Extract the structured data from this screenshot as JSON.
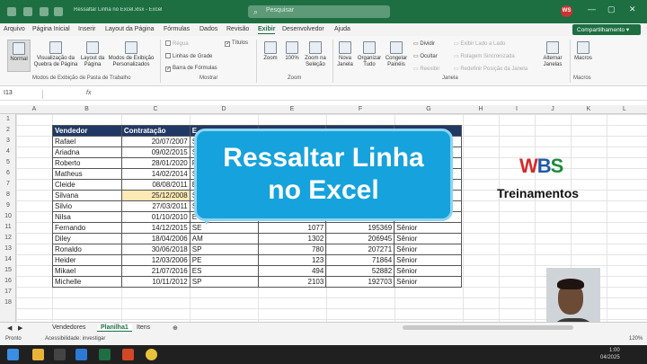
{
  "window": {
    "title": "Ressaltar Linha no Excel.xlsx - Excel",
    "search_placeholder": "Pesquisar",
    "user_initials": "WS",
    "share_label": "Compartilhamento"
  },
  "menu": [
    "Arquivo",
    "Página Inicial",
    "Inserir",
    "Layout da Página",
    "Fórmulas",
    "Dados",
    "Revisão",
    "Exibir",
    "Desenvolvedor",
    "Ajuda"
  ],
  "menu_active": "Exibir",
  "ribbon": {
    "normal": "Normal",
    "quebra": "Visualização da Quebra de Página",
    "layout": "Layout da Página",
    "modos": "Modos de Exibição Personalizados",
    "grp_modos": "Modos de Exibição de Pasta de Trabalho",
    "regua": "Régua",
    "linhas_grade": "Linhas de Grade",
    "barra_formulas": "Barra de Fórmulas",
    "titulos": "Títulos",
    "grp_mostrar": "Mostrar",
    "zoom": "Zoom",
    "zoom100": "100%",
    "zoom_selecao": "Zoom na Seleção",
    "grp_zoom": "Zoom",
    "nova_janela": "Nova Janela",
    "organizar": "Organizar Tudo",
    "congelar": "Congelar Painéis",
    "dividir": "Dividir",
    "ocultar": "Ocultar",
    "reexibir": "Reexibir",
    "exibir_lado": "Exibir Lado a Lado",
    "rolagem": "Rolagem Sincronizada",
    "redefinir": "Redefinir Posição da Janela",
    "grp_janela": "Janela",
    "alternar": "Alternar Janelas",
    "macros": "Macros",
    "grp_macros": "Macros"
  },
  "formula_bar": {
    "name_box": "I13",
    "fx": "fx"
  },
  "columns": [
    "A",
    "B",
    "C",
    "D",
    "E",
    "F",
    "G",
    "H",
    "I",
    "J",
    "K",
    "L"
  ],
  "rows": [
    "1",
    "2",
    "3",
    "4",
    "5",
    "6",
    "7",
    "8",
    "9",
    "10",
    "11",
    "12",
    "13",
    "14",
    "15",
    "16",
    "17",
    "18"
  ],
  "table": {
    "headers": [
      "Vendedor",
      "Contratação",
      "E",
      "",
      "",
      "",
      ""
    ],
    "rows": [
      [
        "Rafael",
        "20/07/2007",
        "S",
        "",
        "",
        "",
        ""
      ],
      [
        "Ariadna",
        "09/02/2015",
        "S",
        "",
        "",
        "",
        ""
      ],
      [
        "Roberto",
        "28/01/2020",
        "R",
        "",
        "",
        "",
        ""
      ],
      [
        "Matheus",
        "14/02/2014",
        "S",
        "",
        "",
        "",
        ""
      ],
      [
        "Cleide",
        "08/08/2011",
        "E",
        "",
        "",
        "",
        ""
      ],
      [
        "Silvana",
        "25/12/2008",
        "S",
        "",
        "",
        "",
        ""
      ],
      [
        "Silvio",
        "27/03/2011",
        "S",
        "",
        "",
        "",
        ""
      ],
      [
        "Nilsa",
        "01/10/2010",
        "E",
        "",
        "",
        "",
        ""
      ],
      [
        "Fernando",
        "14/12/2015",
        "SE",
        "",
        "1077",
        "195369",
        "Sênior"
      ],
      [
        "Diley",
        "18/04/2006",
        "AM",
        "",
        "1302",
        "206945",
        "Sênior"
      ],
      [
        "Ronaldo",
        "30/06/2018",
        "SP",
        "",
        "780",
        "207271",
        "Sênior"
      ],
      [
        "Heider",
        "12/03/2006",
        "PE",
        "",
        "123",
        "71864",
        "Sênior"
      ],
      [
        "Mikael",
        "21/07/2016",
        "ES",
        "",
        "494",
        "52882",
        "Sênior"
      ],
      [
        "Michelle",
        "10/11/2012",
        "SP",
        "",
        "2103",
        "192703",
        "Sênior"
      ]
    ]
  },
  "overlay": {
    "line1": "Ressaltar Linha",
    "line2": "no Excel"
  },
  "logo": {
    "w": "W",
    "b": "B",
    "s": "S",
    "brand": "Treinamentos"
  },
  "sheets": [
    "Vendedores",
    "Planilha1",
    "Itens"
  ],
  "sheet_active": "Planilha1",
  "status": {
    "ready": "Pronto",
    "accessibility": "Acessibilidade: investigar",
    "zoom": "120%"
  },
  "clock": {
    "time": "1:00",
    "date": "04/2025"
  }
}
